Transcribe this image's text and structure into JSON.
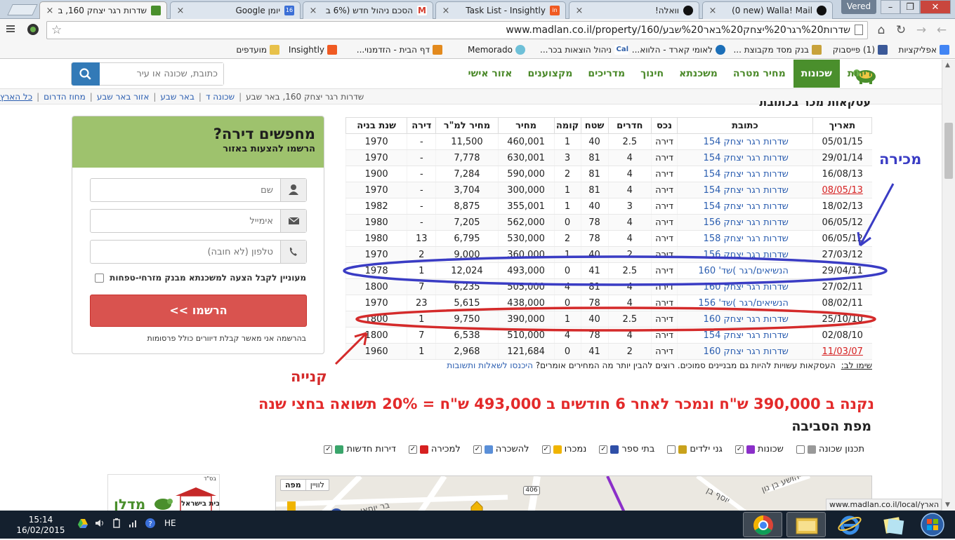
{
  "browser": {
    "tabs": [
      {
        "label": "שדרות רגר יצחק 160, ב",
        "close": "×",
        "active": true,
        "favicon_color": "#4a8f2c"
      },
      {
        "label": "יומן Google",
        "close": "×",
        "active": false,
        "favicon_color": "#3b6fd6",
        "favicon_text": "16"
      },
      {
        "label": "הסכם ניהול חדש (6% ב",
        "close": "×",
        "active": false,
        "favicon_color": "#d53a2b",
        "favicon_text": "M"
      },
      {
        "label": "Task List - Insightly",
        "close": "×",
        "active": false,
        "favicon_color": "#f05a22",
        "favicon_text": "in"
      },
      {
        "label": "וואלה!",
        "close": "×",
        "active": false,
        "favicon_color": "#111"
      },
      {
        "label": "(0 new) Walla! Mail",
        "close": "×",
        "active": false,
        "favicon_color": "#111"
      }
    ],
    "user_name": "Vered",
    "window_controls": [
      "–",
      "❐",
      "✕"
    ],
    "url": "www.madlan.co.il/property/160/שדרות%20רגר%20יצחק%20באר%20שבע",
    "bookmarks": [
      {
        "label": "אפליקציות",
        "icon_color": "#4285f4"
      },
      {
        "label": "(1) פייסבוק",
        "icon_color": "#3b5998"
      },
      {
        "label": "בנק מסד מקבוצת ...",
        "icon_color": "#c8a23b"
      },
      {
        "label": "לאומי קארד - הלווא...",
        "icon_color": "#1c6fb8"
      },
      {
        "label": "ניהול הוצאות בכר...",
        "icon_color": "#2f5fa8",
        "icon_text": "Cal"
      },
      {
        "label": "Memorado",
        "icon_color": "#6ec0d8"
      },
      {
        "label": "דף הבית - הזדמנוי...",
        "icon_color": "#e38a1e"
      },
      {
        "label": "Insightly",
        "icon_color": "#f05a22"
      },
      {
        "label": "מועדפים",
        "icon_color": "#e8c14a"
      }
    ]
  },
  "site": {
    "logo_text": "מדלן",
    "nav": [
      "דירות",
      "שכונות",
      "מחיר מטרה",
      "משכנתא",
      "חינוך",
      "מדריכים",
      "מקצוענים",
      "אזור אישי"
    ],
    "nav_active_index": 1,
    "search_placeholder": "כתובת, שכונה או עיר"
  },
  "breadcrumb": [
    "כל הארץ",
    "מחוז הדרום",
    "אזור באר שבע",
    "באר שבע",
    "שכונה ד",
    "שדרות רגר יצחק 160, באר שבע"
  ],
  "clipped_heading": "עסקאות מכר בכתובת",
  "signup": {
    "title": "מחפשים דירה?",
    "subtitle": "הרשמו להצעות באזור",
    "name_placeholder": "שם",
    "email_placeholder": "אימייל",
    "phone_placeholder": "טלפון (לא חובה)",
    "mortgage_checkbox": "מעוניין לקבל הצעה למשכנתא מבנק מזרחי-טפחות",
    "submit_label": "הרשמו >>",
    "fine_print": "בהרשמה אני מאשר קבלת דיוורים כולל פרסומות"
  },
  "transactions": {
    "columns": [
      "תאריך",
      "כתובת",
      "נכס",
      "חדרים",
      "שטח",
      "קומה",
      "מחיר",
      "מחיר למ\"ר",
      "דירה",
      "שנת בניה"
    ],
    "rows": [
      {
        "date": "05/01/15",
        "address": "שדרות רגר יצחק 154",
        "type": "דירה",
        "rooms": "2.5",
        "area": "40",
        "floor": "1",
        "price": "460,001",
        "ppm": "11,500",
        "apt": "-",
        "year": "1970",
        "red": false
      },
      {
        "date": "29/01/14",
        "address": "שדרות רגר יצחק 154",
        "type": "דירה",
        "rooms": "4",
        "area": "81",
        "floor": "3",
        "price": "630,001",
        "ppm": "7,778",
        "apt": "-",
        "year": "1970",
        "red": false
      },
      {
        "date": "16/08/13",
        "address": "שדרות רגר יצחק 154",
        "type": "דירה",
        "rooms": "4",
        "area": "81",
        "floor": "2",
        "price": "590,000",
        "ppm": "7,284",
        "apt": "-",
        "year": "1900",
        "red": false
      },
      {
        "date": "08/05/13",
        "address": "שדרות רגר יצחק 154",
        "type": "דירה",
        "rooms": "4",
        "area": "81",
        "floor": "1",
        "price": "300,000",
        "ppm": "3,704",
        "apt": "-",
        "year": "1970",
        "red": true
      },
      {
        "date": "18/02/13",
        "address": "שדרות רגר יצחק 154",
        "type": "דירה",
        "rooms": "3",
        "area": "40",
        "floor": "1",
        "price": "355,001",
        "ppm": "8,875",
        "apt": "-",
        "year": "1982",
        "red": false
      },
      {
        "date": "06/05/12",
        "address": "שדרות רגר יצחק 156",
        "type": "דירה",
        "rooms": "4",
        "area": "78",
        "floor": "0",
        "price": "562,000",
        "ppm": "7,205",
        "apt": "-",
        "year": "1980",
        "red": false
      },
      {
        "date": "06/05/12",
        "address": "שדרות רגר יצחק 158",
        "type": "דירה",
        "rooms": "4",
        "area": "78",
        "floor": "2",
        "price": "530,000",
        "ppm": "6,795",
        "apt": "13",
        "year": "1980",
        "red": false
      },
      {
        "date": "27/03/12",
        "address": "שדרות רגר יצחק 156",
        "type": "דירה",
        "rooms": "2",
        "area": "40",
        "floor": "1",
        "price": "360,000",
        "ppm": "9,000",
        "apt": "2",
        "year": "1970",
        "red": false
      },
      {
        "date": "29/04/11",
        "address": "הנשיאים/רגר )שד' 160",
        "type": "דירה",
        "rooms": "2.5",
        "area": "41",
        "floor": "0",
        "price": "493,000",
        "ppm": "12,024",
        "apt": "1",
        "year": "1978",
        "red": false
      },
      {
        "date": "27/02/11",
        "address": "שדרות רגר יצחק 160",
        "type": "דירה",
        "rooms": "4",
        "area": "81",
        "floor": "4",
        "price": "505,000",
        "ppm": "6,235",
        "apt": "7",
        "year": "1800",
        "red": false
      },
      {
        "date": "08/02/11",
        "address": "הנשיאים/רגר )שד' 156",
        "type": "דירה",
        "rooms": "4",
        "area": "78",
        "floor": "0",
        "price": "438,000",
        "ppm": "5,615",
        "apt": "23",
        "year": "1970",
        "red": false
      },
      {
        "date": "25/10/10",
        "address": "שדרות רגר יצחק 160",
        "type": "דירה",
        "rooms": "2.5",
        "area": "40",
        "floor": "1",
        "price": "390,000",
        "ppm": "9,750",
        "apt": "1",
        "year": "1800",
        "red": false
      },
      {
        "date": "02/08/10",
        "address": "שדרות רגר יצחק 154",
        "type": "דירה",
        "rooms": "4",
        "area": "78",
        "floor": "4",
        "price": "510,000",
        "ppm": "6,538",
        "apt": "7",
        "year": "1800",
        "red": false
      },
      {
        "date": "11/03/07",
        "address": "שדרות רגר יצחק 160",
        "type": "דירה",
        "rooms": "2",
        "area": "41",
        "floor": "0",
        "price": "121,684",
        "ppm": "2,968",
        "apt": "1",
        "year": "1960",
        "red": true
      }
    ]
  },
  "note": {
    "label": "שימו לב:",
    "text": "העסקאות עשויות להיות גם מבניינים סמוכים. רוצים להבין יותר מה המחירים אומרים?",
    "link": "היכנסו לשאלות ותשובות"
  },
  "annotations": {
    "sale_label": "מכירה",
    "buy_label": "קנייה",
    "sale_color": "#3a3cc4",
    "buy_color": "#d42a2a"
  },
  "headline": "נקנה ב 390,000 ש\"ח ונמכר לאחר 6 חודשים ב 493,000 ש\"ח = 20% תשואה בחצי שנה",
  "map_section": {
    "title": "מפת הסביבה",
    "layers": [
      {
        "label": "דירות חדשות",
        "checked": true,
        "icon_color": "#3aa56b"
      },
      {
        "label": "למכירה",
        "checked": true,
        "icon_color": "#d62020"
      },
      {
        "label": "להשכרה",
        "checked": true,
        "icon_color": "#5a8fd8"
      },
      {
        "label": "נמכרו",
        "checked": true,
        "icon_color": "#f0b400"
      },
      {
        "label": "בתי ספר",
        "checked": true,
        "icon_color": "#2f4fa8"
      },
      {
        "label": "גני ילדים",
        "checked": false,
        "icon_color": "#c9a21c"
      },
      {
        "label": "שכונות",
        "checked": true,
        "icon_color": "#8b2fc9"
      },
      {
        "label": "תכנון שכונה",
        "checked": false,
        "icon_color": "#999999"
      }
    ],
    "map_tabs": [
      "מפה",
      "לוויין"
    ],
    "road_number": "406",
    "street_labels": [
      "בר יוחאי",
      "יוסף בן",
      "יהושע בן נון"
    ]
  },
  "ad": {
    "brand": "מדלן",
    "partner": "בית בישראל",
    "small_text": "בס\"ד"
  },
  "status_url": "www.madlan.co.il/local/כל הארץ",
  "taskbar": {
    "time": "15:14",
    "date": "16/02/2015",
    "lang": "HE"
  }
}
